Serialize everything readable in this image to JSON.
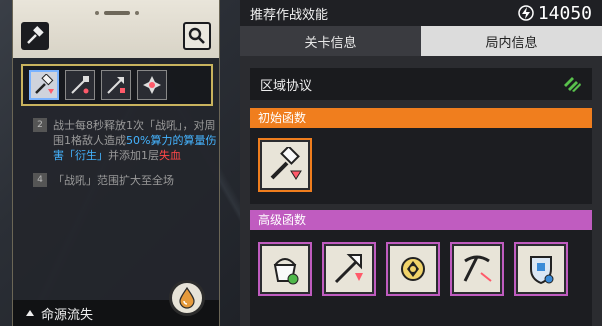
{
  "left_card": {
    "description": [
      {
        "level": "2",
        "parts": [
          {
            "text": "战士每8秒释放1次「战吼」，对周围1格敌人造成",
            "style": "normal"
          },
          {
            "text": "50%算力的算量伤害「衍生」",
            "style": "blue"
          },
          {
            "text": "并添加1层",
            "style": "normal"
          },
          {
            "text": "失血",
            "style": "red"
          }
        ]
      },
      {
        "level": "4",
        "parts": [
          {
            "text": "「战吼」范围扩大至全场",
            "style": "normal"
          }
        ]
      }
    ],
    "bottom_label": "命源流失",
    "icons": [
      "gavel-icon",
      "search-icon",
      "droplet-icon",
      "chevron-up-icon"
    ]
  },
  "right_panel": {
    "top_label": "推荐作战效能",
    "top_value": "14050",
    "tabs": [
      "关卡信息",
      "局内信息"
    ],
    "active_tab_index": 1,
    "region_title": "区域协议",
    "initial_title": "初始函数",
    "advanced_title": "高级函数",
    "colors": {
      "initial": "#f07e1e",
      "advanced": "#c05cc0",
      "accent_blue": "#45b4ff",
      "accent_red": "#ff4848"
    }
  }
}
